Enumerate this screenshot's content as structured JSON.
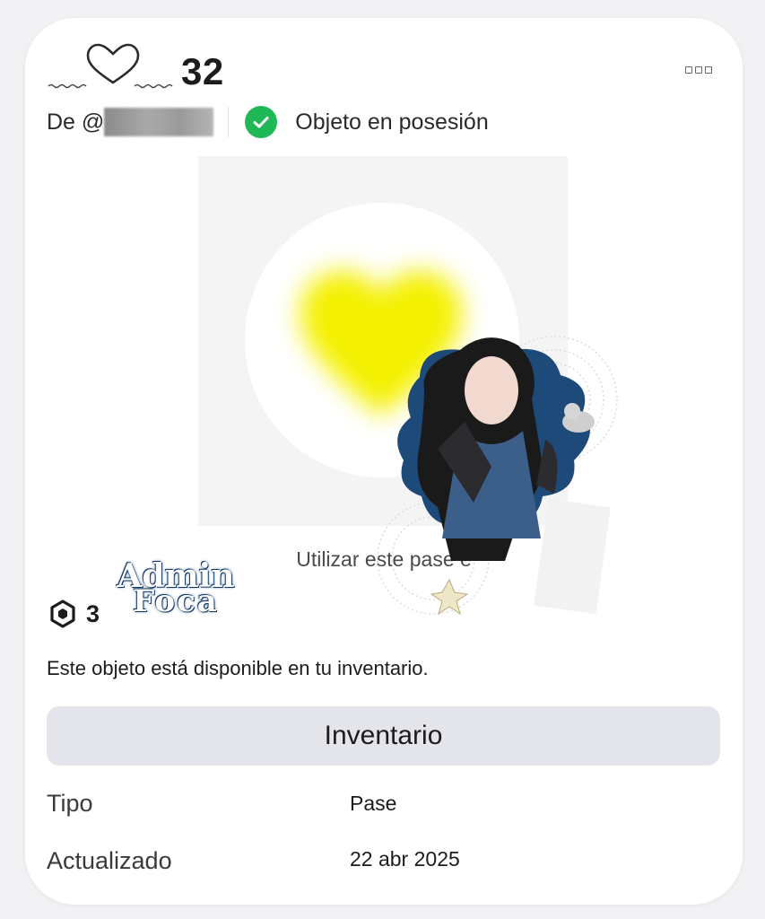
{
  "item": {
    "title": "32",
    "title_decoration_icon": "heart-outline-icon",
    "creator_prefix": "De @",
    "ownership_label": "Objeto en posesión",
    "thumbnail_caption": "Utilizar este pase e",
    "sticker_line1": "Admin",
    "sticker_line2": "Foca",
    "price": "3",
    "currency_icon": "robux-icon",
    "availability_text": "Este objeto está disponible en tu inventario.",
    "inventory_button_label": "Inventario"
  },
  "details": {
    "type_label": "Tipo",
    "type_value": "Pase",
    "updated_label": "Actualizado",
    "updated_value": "22 abr 2025"
  },
  "colors": {
    "owned_green": "#1fb857",
    "button_bg": "#e4e5ea",
    "heart_glow": "#f4f000"
  }
}
